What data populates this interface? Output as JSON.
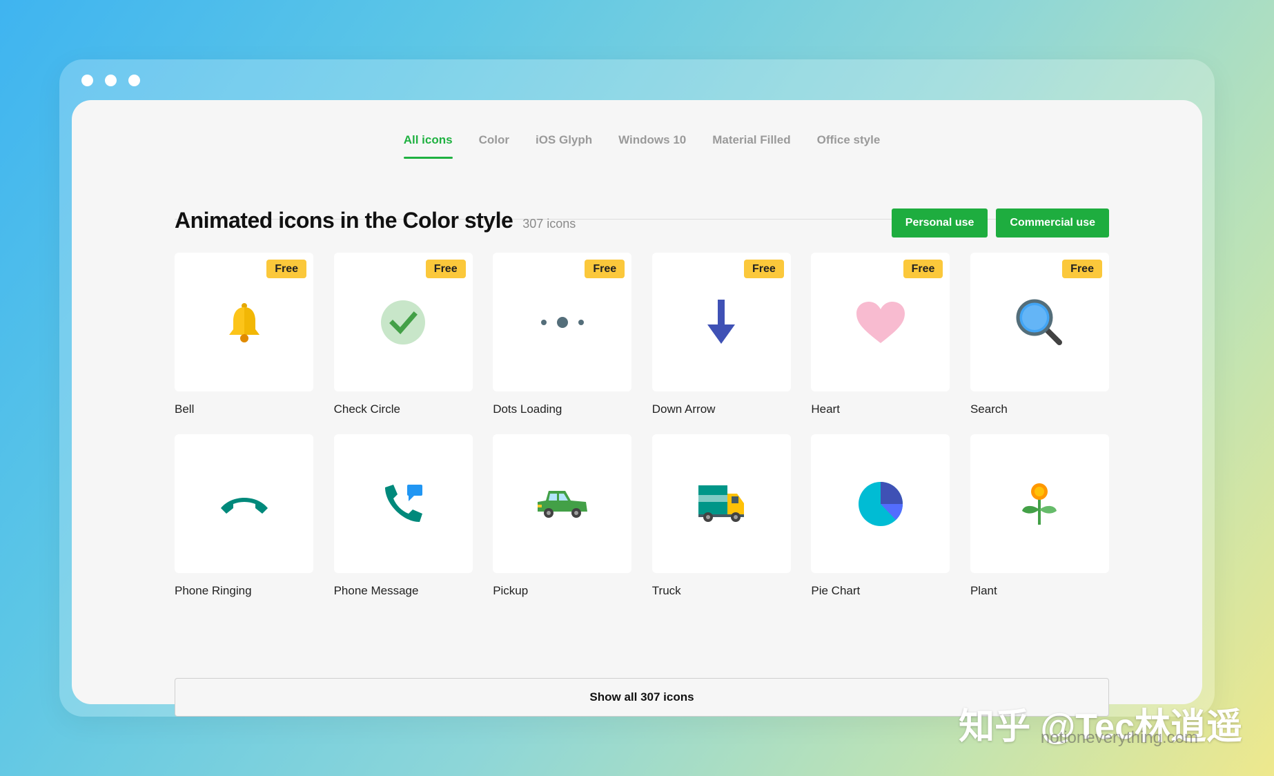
{
  "tabs": [
    {
      "label": "All icons",
      "active": true
    },
    {
      "label": "Color",
      "active": false
    },
    {
      "label": "iOS Glyph",
      "active": false
    },
    {
      "label": "Windows 10",
      "active": false
    },
    {
      "label": "Material Filled",
      "active": false
    },
    {
      "label": "Office style",
      "active": false
    }
  ],
  "heading": {
    "title": "Animated icons in the Color style",
    "count": "307 icons"
  },
  "buttons": {
    "personal": "Personal use",
    "commercial": "Commercial use"
  },
  "badge_label": "Free",
  "icons": [
    {
      "name": "Bell",
      "icon": "bell-icon",
      "free": true
    },
    {
      "name": "Check Circle",
      "icon": "check-circle-icon",
      "free": true
    },
    {
      "name": "Dots Loading",
      "icon": "dots-loading-icon",
      "free": true
    },
    {
      "name": "Down Arrow",
      "icon": "down-arrow-icon",
      "free": true
    },
    {
      "name": "Heart",
      "icon": "heart-icon",
      "free": true
    },
    {
      "name": "Search",
      "icon": "search-icon",
      "free": true
    },
    {
      "name": "Phone Ringing",
      "icon": "phone-ringing-icon",
      "free": false
    },
    {
      "name": "Phone Message",
      "icon": "phone-message-icon",
      "free": false
    },
    {
      "name": "Pickup",
      "icon": "pickup-icon",
      "free": false
    },
    {
      "name": "Truck",
      "icon": "truck-icon",
      "free": false
    },
    {
      "name": "Pie Chart",
      "icon": "pie-chart-icon",
      "free": false
    },
    {
      "name": "Plant",
      "icon": "plant-icon",
      "free": false
    }
  ],
  "show_all": "Show all 307 icons",
  "watermark": {
    "main": "知乎 @Tec林逍遥",
    "sub": "notioneverything.com"
  },
  "colors": {
    "accent": "#1fb141",
    "button": "#1ead3f",
    "badge": "#fbc83b",
    "card": "#ffffff",
    "panel": "#f6f6f6"
  }
}
